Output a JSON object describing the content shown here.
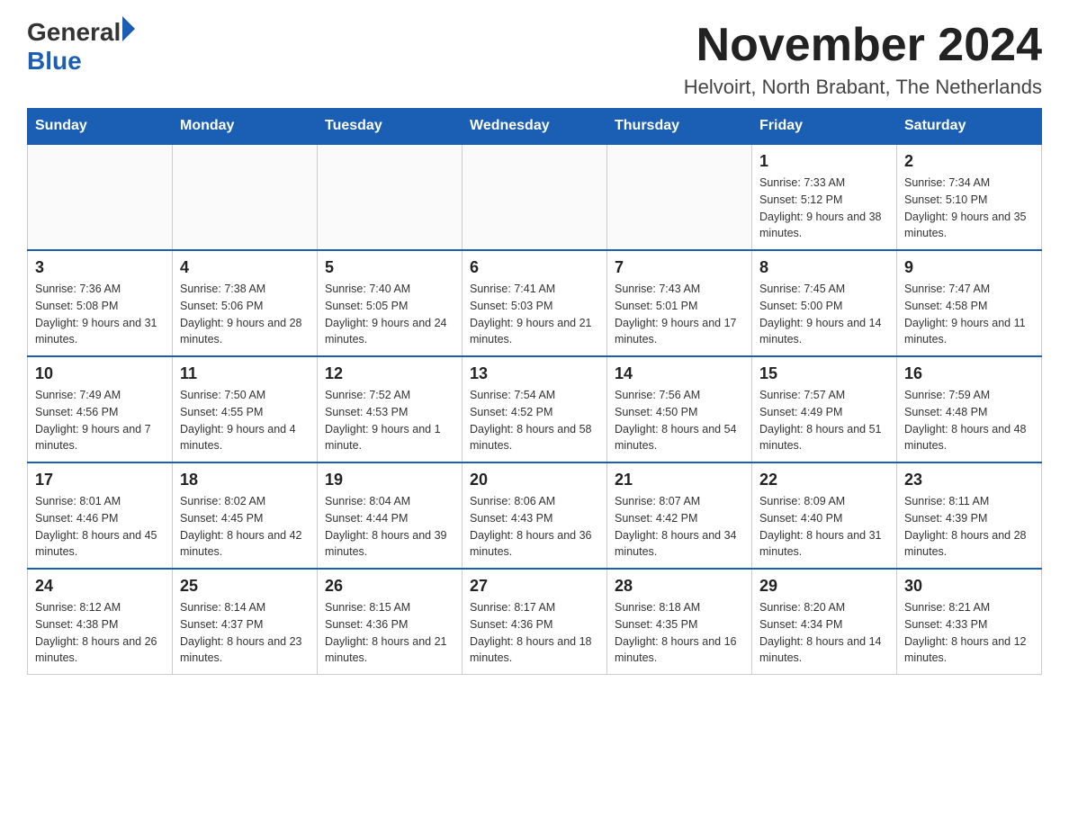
{
  "header": {
    "logo_text_general": "General",
    "logo_text_blue": "Blue",
    "month_title": "November 2024",
    "location": "Helvoirt, North Brabant, The Netherlands"
  },
  "weekdays": [
    "Sunday",
    "Monday",
    "Tuesday",
    "Wednesday",
    "Thursday",
    "Friday",
    "Saturday"
  ],
  "weeks": [
    [
      {
        "day": "",
        "info": ""
      },
      {
        "day": "",
        "info": ""
      },
      {
        "day": "",
        "info": ""
      },
      {
        "day": "",
        "info": ""
      },
      {
        "day": "",
        "info": ""
      },
      {
        "day": "1",
        "info": "Sunrise: 7:33 AM\nSunset: 5:12 PM\nDaylight: 9 hours and 38 minutes."
      },
      {
        "day": "2",
        "info": "Sunrise: 7:34 AM\nSunset: 5:10 PM\nDaylight: 9 hours and 35 minutes."
      }
    ],
    [
      {
        "day": "3",
        "info": "Sunrise: 7:36 AM\nSunset: 5:08 PM\nDaylight: 9 hours and 31 minutes."
      },
      {
        "day": "4",
        "info": "Sunrise: 7:38 AM\nSunset: 5:06 PM\nDaylight: 9 hours and 28 minutes."
      },
      {
        "day": "5",
        "info": "Sunrise: 7:40 AM\nSunset: 5:05 PM\nDaylight: 9 hours and 24 minutes."
      },
      {
        "day": "6",
        "info": "Sunrise: 7:41 AM\nSunset: 5:03 PM\nDaylight: 9 hours and 21 minutes."
      },
      {
        "day": "7",
        "info": "Sunrise: 7:43 AM\nSunset: 5:01 PM\nDaylight: 9 hours and 17 minutes."
      },
      {
        "day": "8",
        "info": "Sunrise: 7:45 AM\nSunset: 5:00 PM\nDaylight: 9 hours and 14 minutes."
      },
      {
        "day": "9",
        "info": "Sunrise: 7:47 AM\nSunset: 4:58 PM\nDaylight: 9 hours and 11 minutes."
      }
    ],
    [
      {
        "day": "10",
        "info": "Sunrise: 7:49 AM\nSunset: 4:56 PM\nDaylight: 9 hours and 7 minutes."
      },
      {
        "day": "11",
        "info": "Sunrise: 7:50 AM\nSunset: 4:55 PM\nDaylight: 9 hours and 4 minutes."
      },
      {
        "day": "12",
        "info": "Sunrise: 7:52 AM\nSunset: 4:53 PM\nDaylight: 9 hours and 1 minute."
      },
      {
        "day": "13",
        "info": "Sunrise: 7:54 AM\nSunset: 4:52 PM\nDaylight: 8 hours and 58 minutes."
      },
      {
        "day": "14",
        "info": "Sunrise: 7:56 AM\nSunset: 4:50 PM\nDaylight: 8 hours and 54 minutes."
      },
      {
        "day": "15",
        "info": "Sunrise: 7:57 AM\nSunset: 4:49 PM\nDaylight: 8 hours and 51 minutes."
      },
      {
        "day": "16",
        "info": "Sunrise: 7:59 AM\nSunset: 4:48 PM\nDaylight: 8 hours and 48 minutes."
      }
    ],
    [
      {
        "day": "17",
        "info": "Sunrise: 8:01 AM\nSunset: 4:46 PM\nDaylight: 8 hours and 45 minutes."
      },
      {
        "day": "18",
        "info": "Sunrise: 8:02 AM\nSunset: 4:45 PM\nDaylight: 8 hours and 42 minutes."
      },
      {
        "day": "19",
        "info": "Sunrise: 8:04 AM\nSunset: 4:44 PM\nDaylight: 8 hours and 39 minutes."
      },
      {
        "day": "20",
        "info": "Sunrise: 8:06 AM\nSunset: 4:43 PM\nDaylight: 8 hours and 36 minutes."
      },
      {
        "day": "21",
        "info": "Sunrise: 8:07 AM\nSunset: 4:42 PM\nDaylight: 8 hours and 34 minutes."
      },
      {
        "day": "22",
        "info": "Sunrise: 8:09 AM\nSunset: 4:40 PM\nDaylight: 8 hours and 31 minutes."
      },
      {
        "day": "23",
        "info": "Sunrise: 8:11 AM\nSunset: 4:39 PM\nDaylight: 8 hours and 28 minutes."
      }
    ],
    [
      {
        "day": "24",
        "info": "Sunrise: 8:12 AM\nSunset: 4:38 PM\nDaylight: 8 hours and 26 minutes."
      },
      {
        "day": "25",
        "info": "Sunrise: 8:14 AM\nSunset: 4:37 PM\nDaylight: 8 hours and 23 minutes."
      },
      {
        "day": "26",
        "info": "Sunrise: 8:15 AM\nSunset: 4:36 PM\nDaylight: 8 hours and 21 minutes."
      },
      {
        "day": "27",
        "info": "Sunrise: 8:17 AM\nSunset: 4:36 PM\nDaylight: 8 hours and 18 minutes."
      },
      {
        "day": "28",
        "info": "Sunrise: 8:18 AM\nSunset: 4:35 PM\nDaylight: 8 hours and 16 minutes."
      },
      {
        "day": "29",
        "info": "Sunrise: 8:20 AM\nSunset: 4:34 PM\nDaylight: 8 hours and 14 minutes."
      },
      {
        "day": "30",
        "info": "Sunrise: 8:21 AM\nSunset: 4:33 PM\nDaylight: 8 hours and 12 minutes."
      }
    ]
  ]
}
